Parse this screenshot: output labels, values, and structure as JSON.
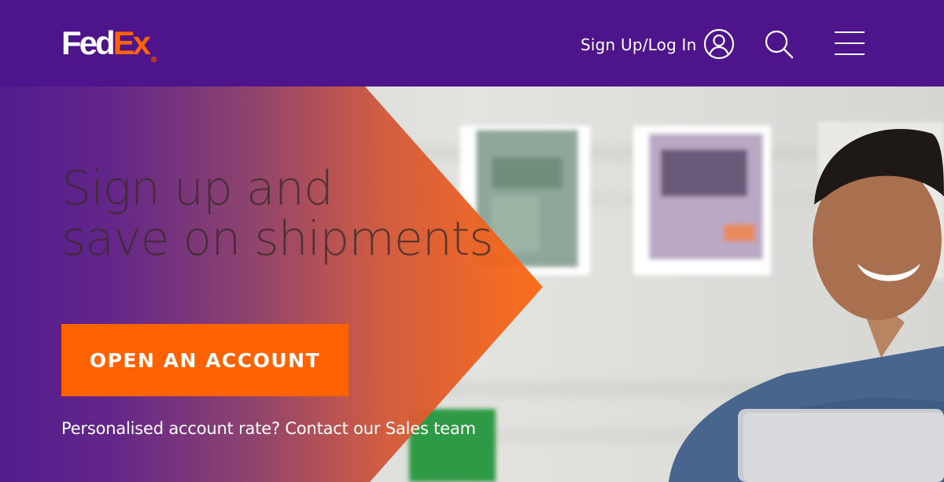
{
  "brand": {
    "logo_fed": "Fed",
    "logo_ex": "Ex",
    "logo_reg": "®",
    "purple": "#4d148c",
    "orange": "#ff6200"
  },
  "header": {
    "signin_label": "Sign Up/Log In",
    "icons": [
      "user-icon",
      "search-icon",
      "hamburger-menu-icon"
    ]
  },
  "hero": {
    "headline_line1": "Sign up and",
    "headline_line2": "save on shipments",
    "cta_label": "OPEN AN ACCOUNT",
    "contact_link": "Personalised account rate? Contact our Sales team"
  }
}
